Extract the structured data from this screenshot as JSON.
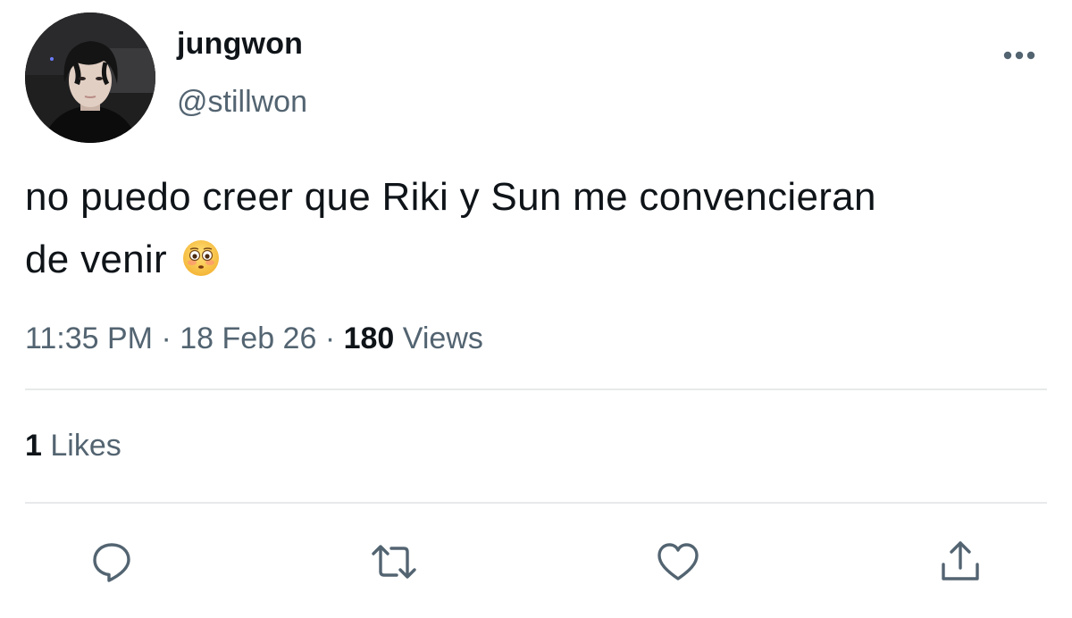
{
  "tweet": {
    "author": {
      "display_name": "jungwon",
      "handle": "@stillwon",
      "avatar": "profile-photo"
    },
    "text_line1": "no puedo creer que Riki y Sun me convencieran",
    "text_line2": "de venir",
    "emoji": "flushed-face-emoji",
    "time": "11:35 PM",
    "separator": "·",
    "date": "18 Feb 26",
    "views_count": "180",
    "views_label": "Views",
    "likes_count": "1",
    "likes_label": "Likes"
  },
  "actions": [
    {
      "name": "reply",
      "icon": "reply-icon"
    },
    {
      "name": "retweet",
      "icon": "retweet-icon"
    },
    {
      "name": "like",
      "icon": "heart-icon"
    },
    {
      "name": "share",
      "icon": "share-icon"
    }
  ],
  "colors": {
    "primary_text": "#0f1419",
    "secondary_text": "#536471",
    "divider": "#e7e9ea",
    "background": "#ffffff"
  }
}
